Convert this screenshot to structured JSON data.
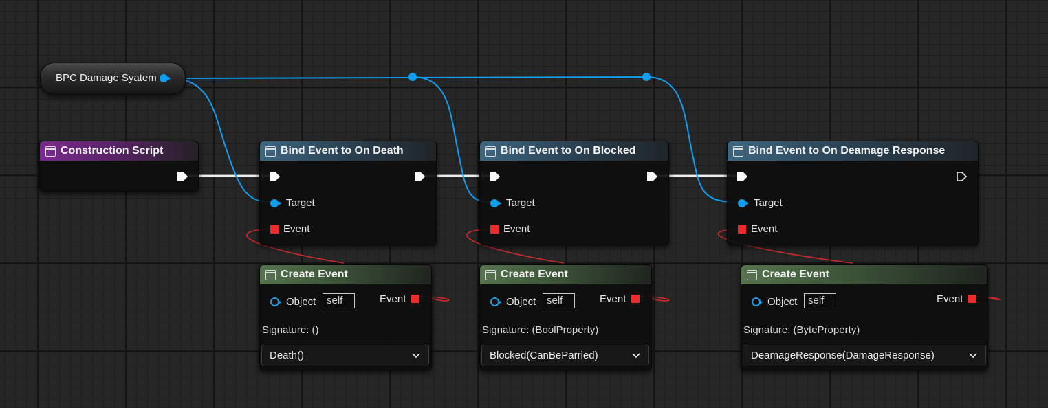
{
  "variable_node": {
    "label": "BPC Damage Syatem"
  },
  "construction_node": {
    "title": "Construction Script"
  },
  "bind_nodes": [
    {
      "title": "Bind Event to On Death",
      "target_label": "Target",
      "event_label": "Event"
    },
    {
      "title": "Bind Event to On Blocked",
      "target_label": "Target",
      "event_label": "Event"
    },
    {
      "title": "Bind Event to On Deamage Response",
      "target_label": "Target",
      "event_label": "Event"
    }
  ],
  "create_nodes": [
    {
      "title": "Create Event",
      "object_label": "Object",
      "object_value": "self",
      "event_label": "Event",
      "signature": "Signature: ()",
      "function": "Death()"
    },
    {
      "title": "Create Event",
      "object_label": "Object",
      "object_value": "self",
      "event_label": "Event",
      "signature": "Signature: (BoolProperty)",
      "function": "Blocked(CanBeParried)"
    },
    {
      "title": "Create Event",
      "object_label": "Object",
      "object_value": "self",
      "event_label": "Event",
      "signature": "Signature: (ByteProperty)",
      "function": "DeamageResponse(DamageResponse)"
    }
  ],
  "colors": {
    "exec_wire": "#ffffff",
    "object_wire": "#109ff0",
    "delegate_wire": "#d6262b",
    "event_pin": "#ee2b2b",
    "header_event": "#7a2a8e",
    "header_function": "#3e6680",
    "header_create": "#56744e"
  },
  "icons": {
    "node": "function-node-icon",
    "exec": "exec-pin-arrow",
    "dropdown": "chevron-down-icon"
  }
}
